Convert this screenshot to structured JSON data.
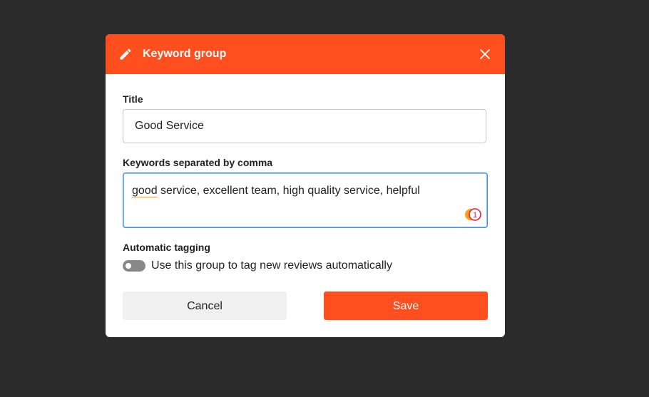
{
  "dialog": {
    "title": "Keyword group",
    "title_label": "Title",
    "title_value": "Good Service",
    "keywords_label": "Keywords separated by comma",
    "keywords_first_word": "good",
    "keywords_rest": " service, excellent team, high quality service, helpful",
    "spellcheck_count": "1",
    "auto_tagging_label": "Automatic tagging",
    "auto_tagging_desc": "Use this group to tag new reviews automatically",
    "auto_tagging_enabled": false,
    "cancel_label": "Cancel",
    "save_label": "Save",
    "accent_color": "#ff4f1f"
  }
}
